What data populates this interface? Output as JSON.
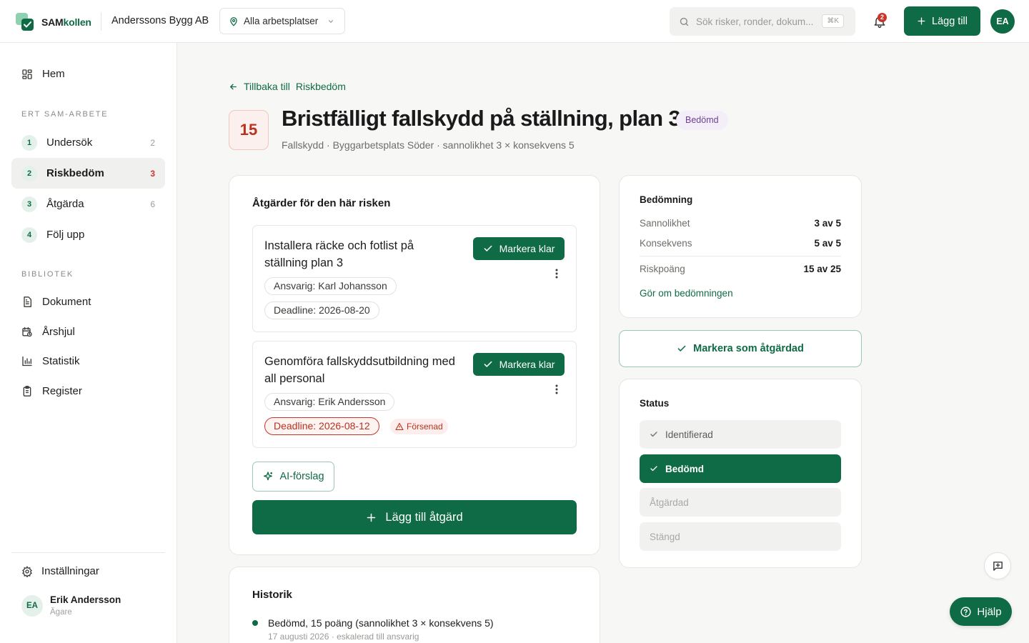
{
  "brand": {
    "part1": "SAM",
    "part2": "kollen"
  },
  "header": {
    "company": "Anderssons Bygg AB",
    "workplace": "Alla arbetsplatser",
    "search_placeholder": "Sök risker, ronder, dokum...",
    "search_shortcut": "⌘K",
    "notification_count": "2",
    "add_label": "Lägg till",
    "user_initials": "EA"
  },
  "sidebar": {
    "home": "Hem",
    "section_work": "ERT SAM-ARBETE",
    "steps": [
      {
        "num": "1",
        "label": "Undersök",
        "count": "2"
      },
      {
        "num": "2",
        "label": "Riskbedöm",
        "count": "3"
      },
      {
        "num": "3",
        "label": "Åtgärda",
        "count": "6"
      },
      {
        "num": "4",
        "label": "Följ upp",
        "count": ""
      }
    ],
    "section_library": "BIBLIOTEK",
    "library": [
      {
        "label": "Dokument",
        "icon": "document-icon"
      },
      {
        "label": "Årshjul",
        "icon": "calendar-cycle-icon"
      },
      {
        "label": "Statistik",
        "icon": "bar-chart-icon"
      },
      {
        "label": "Register",
        "icon": "clipboard-icon"
      }
    ],
    "settings": "Inställningar",
    "user": {
      "initials": "EA",
      "name": "Erik Andersson",
      "role": "Ägare"
    }
  },
  "page": {
    "back_prefix": "Tillbaka till",
    "back_target": "Riskbedöm",
    "score": "15",
    "title": "Bristfälligt fallskydd på ställning, plan 3",
    "status_badge": "Bedömd",
    "subtitle": "Fallskydd · Byggarbetsplats Söder · sannolikhet 3 × konsekvens 5"
  },
  "actions_card": {
    "heading": "Åtgärder för den här risken",
    "items": [
      {
        "title": "Installera räcke och fotlist på ställning plan 3",
        "done_label": "Markera klar",
        "responsible": "Ansvarig: Karl Johansson",
        "deadline": "Deadline: 2026-08-20",
        "late": ""
      },
      {
        "title": "Genomföra fallskyddsutbildning med all personal",
        "done_label": "Markera klar",
        "responsible": "Ansvarig: Erik Andersson",
        "deadline": "Deadline: 2026-08-12",
        "late": "Försenad"
      }
    ],
    "ai_label": "AI-förslag",
    "add_label": "Lägg till åtgärd"
  },
  "assessment": {
    "heading": "Bedömning",
    "rows": [
      {
        "key": "Sannolikhet",
        "value": "3 av 5"
      },
      {
        "key": "Konsekvens",
        "value": "5 av 5"
      },
      {
        "key": "Riskpoäng",
        "value": "15 av 25"
      }
    ],
    "redo_label": "Gör om bedömningen"
  },
  "resolve_label": "Markera som åtgärdad",
  "status": {
    "heading": "Status",
    "steps": [
      "Identifierad",
      "Bedömd",
      "Åtgärdad",
      "Stängd"
    ]
  },
  "history": {
    "heading": "Historik",
    "entry_text": "Bedömd, 15 poäng (sannolikhet 3 × konsekvens 5)",
    "entry_meta": "17 augusti 2026 · eskalerad till ansvarig"
  },
  "help_label": "Hjälp",
  "colors": {
    "brand": "#0f6b45",
    "danger": "#c9342b",
    "badge": "#6d3f95"
  }
}
